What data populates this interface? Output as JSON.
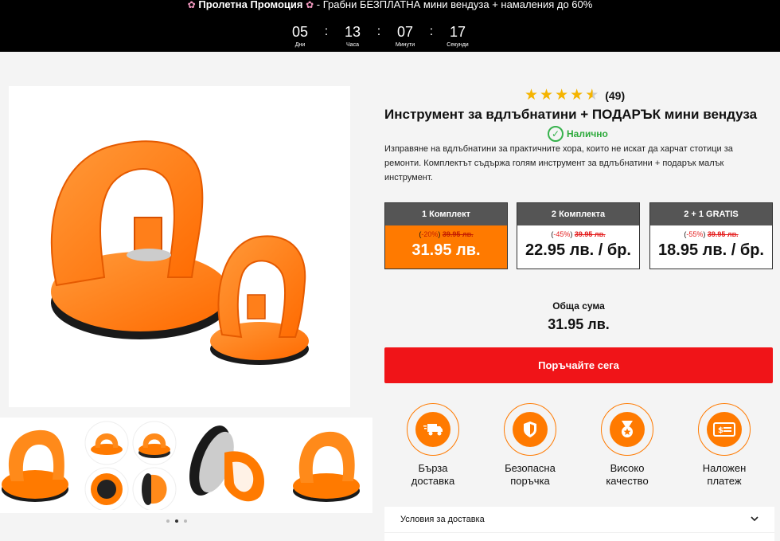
{
  "promo": {
    "bold_text": "Пролетна Промоция",
    "text": " - Грабни БЕЗПЛАТНА мини вендуза + намаления до 60%",
    "icon": "flower-icon"
  },
  "countdown": [
    {
      "value": "05",
      "label": "Дни"
    },
    {
      "value": "13",
      "label": "Часа"
    },
    {
      "value": "07",
      "label": "Минути"
    },
    {
      "value": "17",
      "label": "Секунди"
    }
  ],
  "product": {
    "rating_stars": 4.5,
    "rating_count": "(49)",
    "title": "Инструмент за вдлъбнатини + ПОДАРЪК мини вендуза",
    "stock": "Налично",
    "description": "Изправяне на вдлъбнатини за практичните хора, които не искат да харчат стотици за ремонти. Комплектът съдържа голям инструмент за вдлъбнатини + подарък малък инструмент."
  },
  "bundles": [
    {
      "title": "1 Комплект",
      "discount": "-20%",
      "old_price": "39.95 лв.",
      "price": "31.95 лв.",
      "selected": true
    },
    {
      "title": "2 Комплекта",
      "discount": "-45%",
      "old_price": "39.95 лв.",
      "price": "22.95 лв. / бр.",
      "selected": false
    },
    {
      "title": "2 + 1 GRATIS",
      "discount": "-55%",
      "old_price": "39.95 лв.",
      "price": "18.95 лв. / бр.",
      "selected": false
    }
  ],
  "total": {
    "label": "Обща сума",
    "value": "31.95 лв."
  },
  "order_button": "Поръчайте сега",
  "features": [
    {
      "icon": "delivery-truck-icon",
      "line1": "Бърза",
      "line2": "доставка"
    },
    {
      "icon": "shield-icon",
      "line1": "Безопасна",
      "line2": "поръчка"
    },
    {
      "icon": "medal-icon",
      "line1": "Високо",
      "line2": "качество"
    },
    {
      "icon": "cash-icon",
      "line1": "Наложен",
      "line2": "платеж"
    }
  ],
  "accordion": {
    "label": "Условия за доставка",
    "icon": "chevron-down-icon"
  },
  "gallery": {
    "active_dot": 1,
    "dot_count": 3
  },
  "colors": {
    "accent": "#ff7a00",
    "cta": "#f01418",
    "stock": "#2eaa3c"
  }
}
